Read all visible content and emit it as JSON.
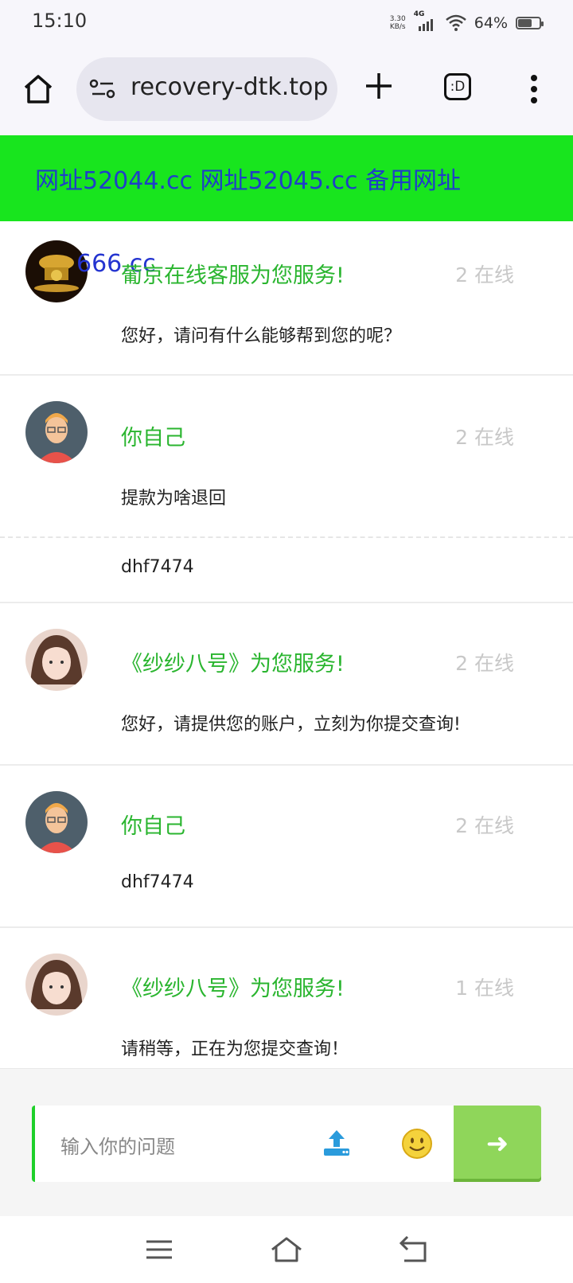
{
  "status": {
    "time": "15:10",
    "speed": "3.30",
    "speed_unit": "KB/s",
    "network": "4G",
    "battery": "64%"
  },
  "browser": {
    "url": "recovery-dtk.top",
    "tab_label": ":D"
  },
  "banner": {
    "text": "网址52044.cc 网址52045.cc 备用网址"
  },
  "overlay": {
    "text": "666.cc"
  },
  "messages": [
    {
      "name": "葡京在线客服为您服务!",
      "online": "2 在线",
      "lines": [
        "您好，请问有什么能够帮到您的呢？"
      ]
    },
    {
      "name": "你自己",
      "online": "2 在线",
      "lines": [
        "提款为啥退回",
        "dhf7474"
      ]
    },
    {
      "name": "《纱纱八号》为您服务!",
      "online": "2 在线",
      "lines": [
        "您好，请提供您的账户，立刻为你提交查询!"
      ]
    },
    {
      "name": "你自己",
      "online": "2 在线",
      "lines": [
        "dhf7474"
      ]
    },
    {
      "name": "《纱纱八号》为您服务!",
      "online": "1 在线",
      "lines": [
        "请稍等，正在为您提交查询！"
      ]
    }
  ],
  "input": {
    "placeholder": "输入你的问题"
  },
  "send": {
    "label": "➜"
  }
}
